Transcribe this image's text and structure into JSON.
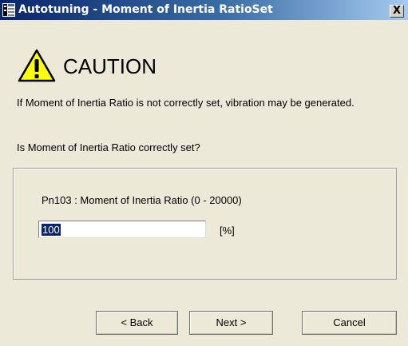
{
  "window": {
    "title": "Autotuning - Moment of Inertia RatioSet",
    "close_glyph": "X",
    "app_icon": "app-icon",
    "close_icon": "close-icon"
  },
  "caution": {
    "icon": "warning-icon",
    "title": "CAUTION",
    "message": "If Moment of Inertia Ratio is not correctly set, vibration may be generated.",
    "question": "Is Moment of Inertia Ratio correctly set?"
  },
  "parameter": {
    "label": "Pn103 : Moment of Inertia Ratio (0 - 20000)",
    "value": "100",
    "unit": "[%]"
  },
  "buttons": {
    "back": "< Back",
    "next": "Next >",
    "cancel": "Cancel"
  },
  "colors": {
    "titlebar_start": "#0a246a",
    "titlebar_end": "#a6caf0",
    "window_bg": "#ece9d8",
    "warning_yellow": "#ffff00"
  }
}
